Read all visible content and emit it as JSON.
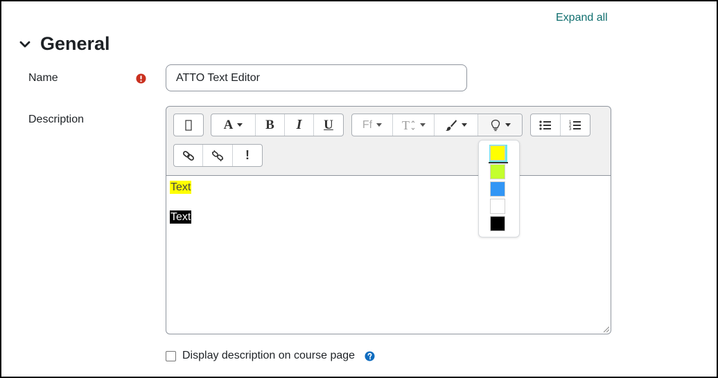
{
  "header": {
    "expand_all": "Expand all",
    "section_title": "General"
  },
  "form": {
    "name_label": "Name",
    "name_value": "ATTO Text Editor",
    "description_label": "Description",
    "display_description_label": "Display description on course page"
  },
  "editor": {
    "content_lines": [
      "Text",
      "Text"
    ],
    "toolbar": {
      "font_family_label": "Ff",
      "bold_label": "B",
      "italic_label": "I",
      "underline_label": "U",
      "font_color_label": "A",
      "special_label": "!"
    },
    "highlight_colors": [
      "#ffff00",
      "#c4ff2e",
      "#3296f5",
      "#ffffff",
      "#000000"
    ]
  },
  "colors": {
    "link": "#0f6e6e",
    "required": "#ca3120",
    "help": "#0f6cbf"
  }
}
